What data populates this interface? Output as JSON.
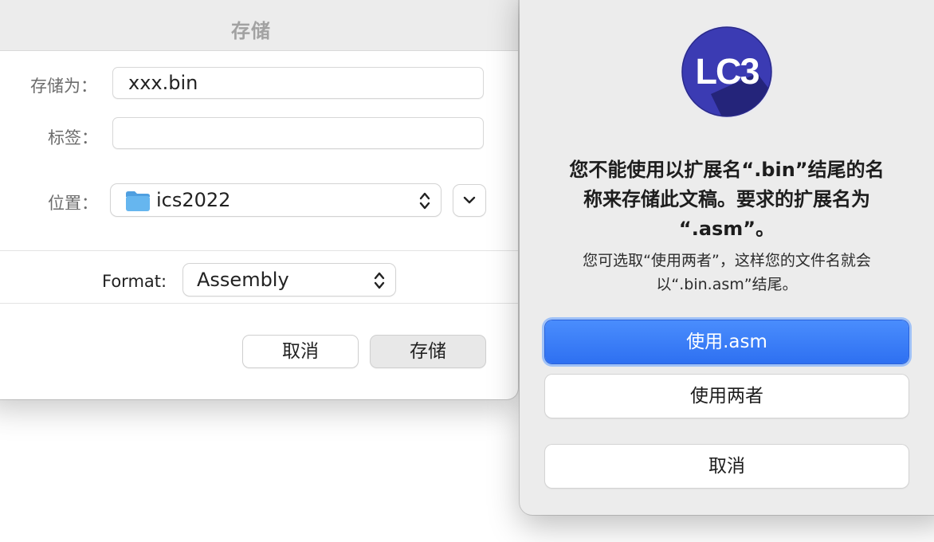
{
  "save_dialog": {
    "title": "存储",
    "save_as_label": "存储为：",
    "save_as_value": "xxx.bin",
    "tags_label": "标签：",
    "tags_value": "",
    "location_label": "位置：",
    "location_value": "ics2022",
    "format_label": "Format:",
    "format_value": "Assembly",
    "cancel_label": "取消",
    "save_label": "存储"
  },
  "alert": {
    "app_icon_text": "LC3",
    "heading_line1": "您不能使用以扩展名“.bin”结尾的名",
    "heading_line2": "称来存储此文稿。要求的扩展名为",
    "heading_line3": "“.asm”。",
    "body_line1": "您可选取“使用两者”，这样您的文件名就会",
    "body_line2": "以“.bin.asm”结尾。",
    "use_asm_label": "使用.asm",
    "use_both_label": "使用两者",
    "cancel_label": "取消"
  },
  "icons": {
    "folder": "folder-icon",
    "updown": "updown-chevron-icon",
    "chevron_down": "chevron-down-icon"
  },
  "colors": {
    "accent": "#2e70f1",
    "folder_blue": "#5aa9e6",
    "lc3_icon": "#3a3ab0"
  }
}
